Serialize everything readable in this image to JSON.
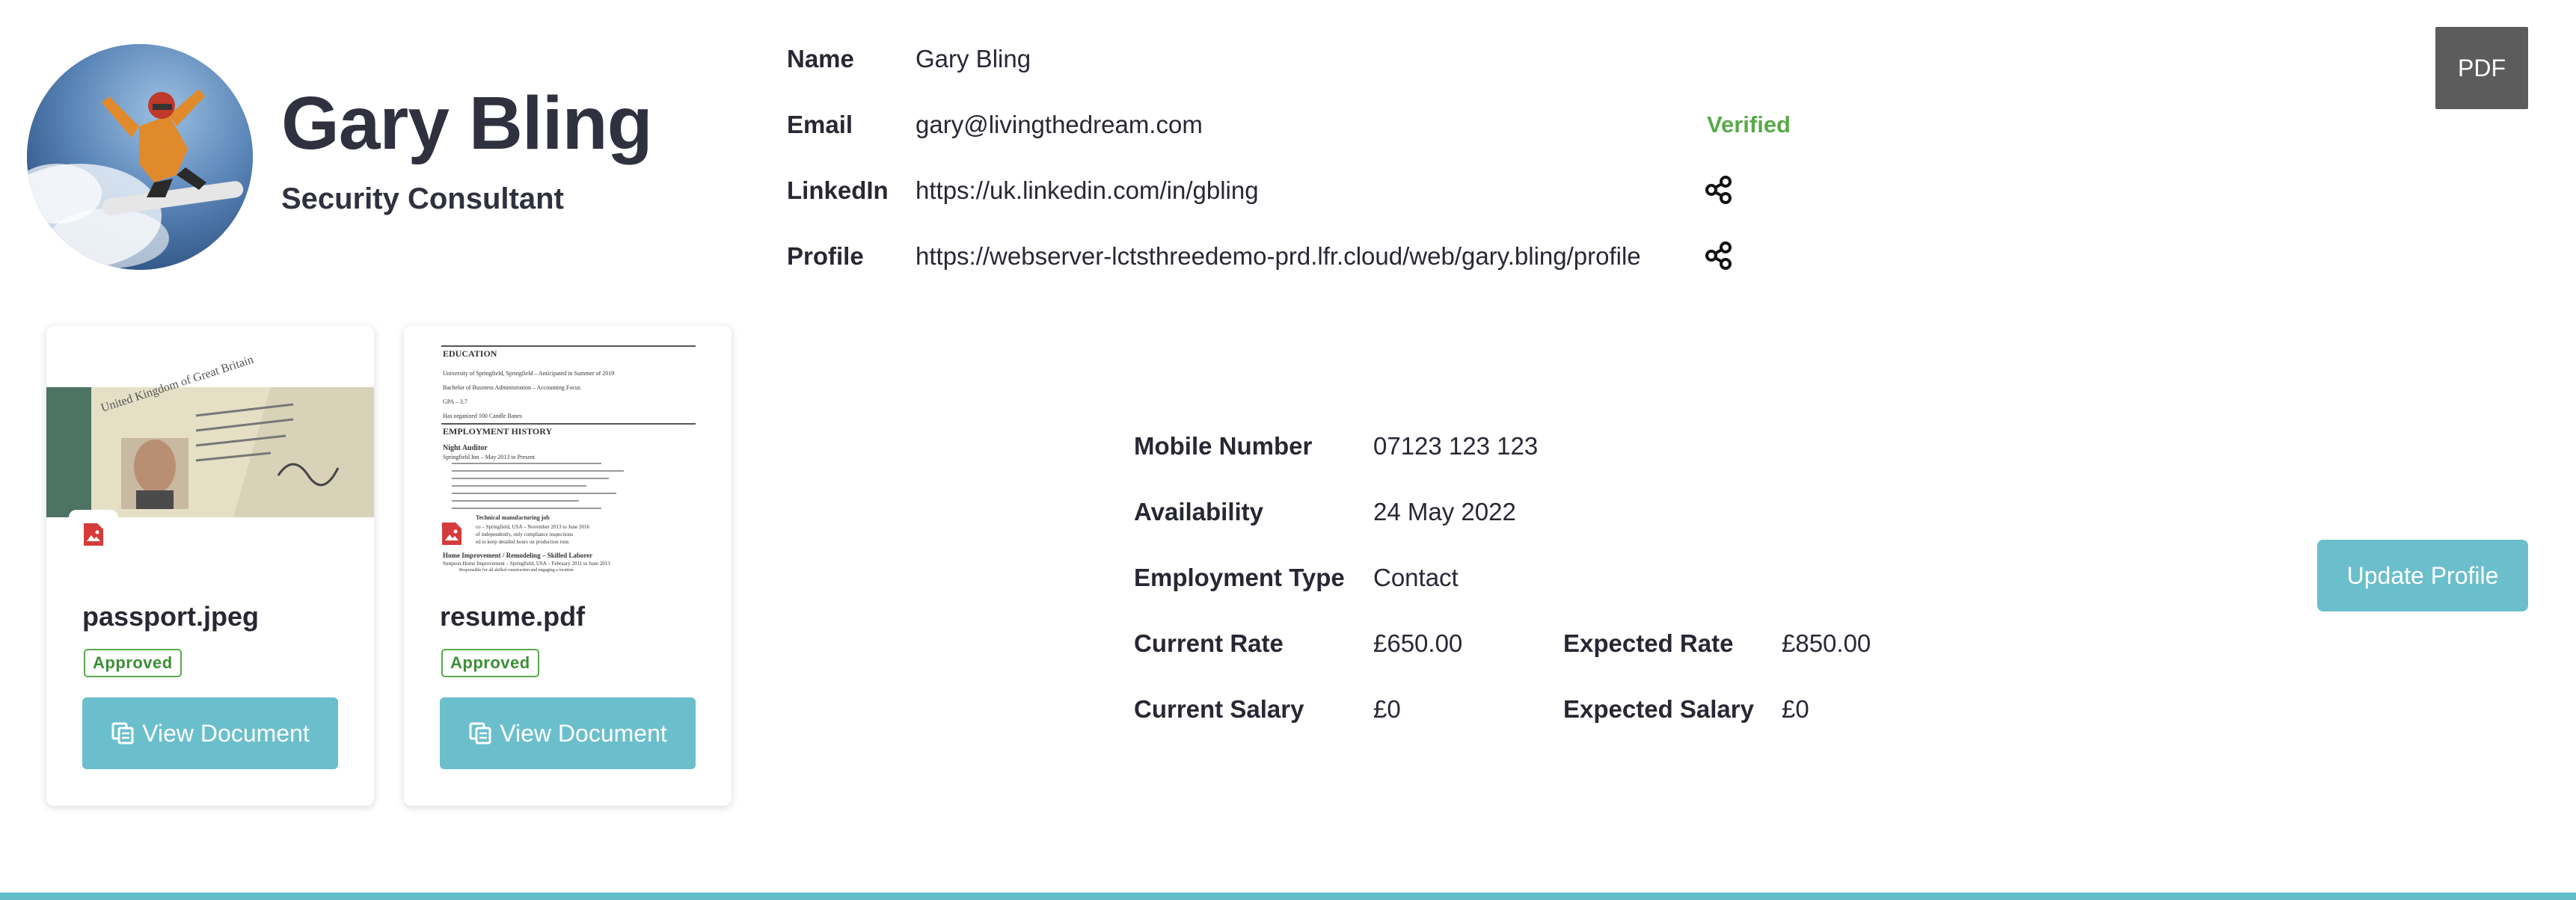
{
  "profile": {
    "name": "Gary Bling",
    "title": "Security Consultant"
  },
  "contact": {
    "name_label": "Name",
    "name_value": "Gary Bling",
    "email_label": "Email",
    "email_value": "gary@livingthedream.com",
    "email_status": "Verified",
    "linkedin_label": "LinkedIn",
    "linkedin_value": "https://uk.linkedin.com/in/gbling",
    "profile_label": "Profile",
    "profile_value": "https://webserver-lctsthreedemo-prd.lfr.cloud/web/gary.bling/profile"
  },
  "toolbar": {
    "pdf_label": "PDF"
  },
  "documents": [
    {
      "filename": "passport.jpeg",
      "status": "Approved",
      "button_label": "View Document"
    },
    {
      "filename": "resume.pdf",
      "status": "Approved",
      "button_label": "View Document"
    }
  ],
  "resume_preview": {
    "education_heading": "EDUCATION",
    "education_lines": [
      "University of Springfield, Springfield – Anticipated in Summer of 2019",
      "Bachelor of Business Administration – Accounting Focus",
      "GPA – 3.7",
      "Has organized 100 Candle Banes"
    ],
    "employment_heading": "EMPLOYMENT HISTORY",
    "job1_title": "Night Auditor",
    "job1_place": "Springfield Inn – May 2013 to Present",
    "job2_title": "Technical manufacturing job",
    "job2_lines": [
      "co – Springfield, USA – November 2013 to June 2016",
      "of independently, only compliance inspections",
      "ed to keep detailed hours on production runs"
    ],
    "job3_title": "Home Improvement / Remodeling – Skilled Laborer",
    "job3_place": "Simpson Home Improvement – Springfield, USA – February 2011 to June 2013",
    "job3_bullet": "Responsible for all skilled construction and engaging a location"
  },
  "details": {
    "mobile_label": "Mobile Number",
    "mobile_value": "07123 123 123",
    "availability_label": "Availability",
    "availability_value": "24 May 2022",
    "employment_label": "Employment Type",
    "employment_value": "Contact",
    "current_rate_label": "Current Rate",
    "current_rate_value": "£650.00",
    "expected_rate_label": "Expected Rate",
    "expected_rate_value": "£850.00",
    "current_salary_label": "Current Salary",
    "current_salary_value": "£0",
    "expected_salary_label": "Expected Salary",
    "expected_salary_value": "£0"
  },
  "actions": {
    "update_label": "Update Profile"
  },
  "colors": {
    "accent": "#6bbfcc",
    "verified": "#59a94a",
    "pdf_button": "#5c5c5c",
    "text": "#272833"
  }
}
